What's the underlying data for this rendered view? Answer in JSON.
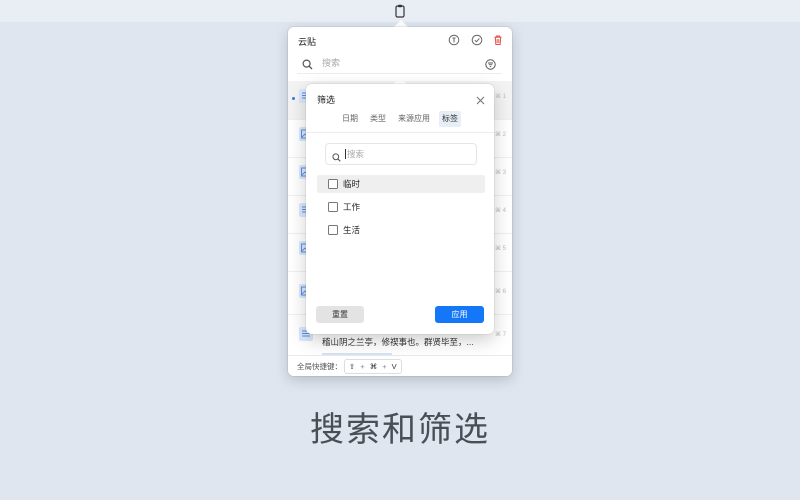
{
  "menubar": {
    "icon": "clipboard-icon"
  },
  "panel": {
    "title": "云贴",
    "header_icons": [
      "pin-icon",
      "check-circle-icon",
      "trash-icon"
    ],
    "trash_color": "#e5534b",
    "search": {
      "placeholder": "搜索"
    },
    "list": {
      "shortcuts": [
        "⌘ 1",
        "⌘ 2",
        "⌘ 3",
        "⌘ 4",
        "⌘ 5",
        "⌘ 6",
        "⌘ 7"
      ],
      "last_item_text": "稽山阴之兰亭，修禊事也。群贤毕至，..."
    },
    "footer": {
      "label": "全局快捷键：",
      "keys": [
        "⇧",
        "⌘",
        "V"
      ],
      "plus": "+"
    }
  },
  "filter": {
    "title": "筛选",
    "tabs": [
      "日期",
      "类型",
      "来源应用",
      "标签"
    ],
    "active_tab": 3,
    "search_placeholder": "搜索",
    "tags": [
      "临时",
      "工作",
      "生活"
    ],
    "reset_label": "重置",
    "apply_label": "应用",
    "accent": "#1477f8"
  },
  "caption": "搜索和筛选"
}
